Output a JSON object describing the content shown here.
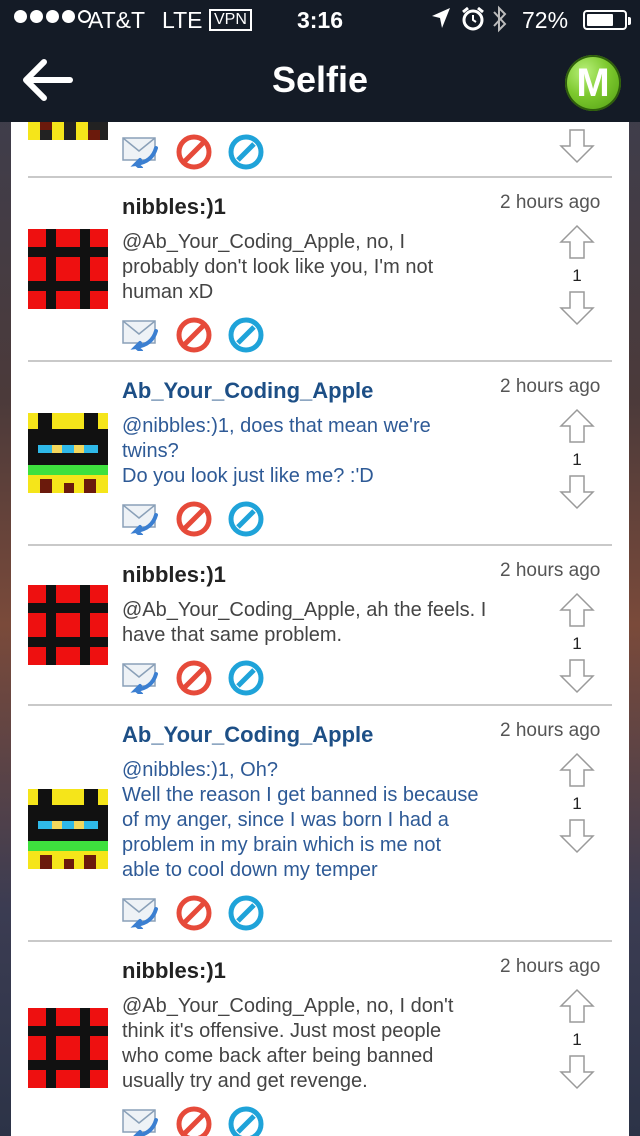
{
  "status_bar": {
    "carrier": "AT&T",
    "network": "LTE",
    "vpn": "VPN",
    "time": "3:16",
    "battery": "72%",
    "battery_level": 0.72,
    "icons": [
      "signal-dots",
      "location-icon",
      "alarm-icon",
      "bluetooth-icon",
      "battery-icon"
    ]
  },
  "nav": {
    "title": "Selfie",
    "back_icon": "back-arrow-icon",
    "menu_label": "M"
  },
  "colors": {
    "nav_bg": "#141b26",
    "menu_button": "#7cc82d",
    "username_blue": "#1d4f86",
    "body_blue": "#2e5a96",
    "deny_red": "#e64a3a",
    "edit_blue": "#1fa3d9"
  },
  "posts": [
    {
      "user": "nibbles:)1",
      "time": "2 hours ago",
      "lines": [
        "@Ab_Your_Coding_Apple, no, I",
        "probably don't look like you, I'm not",
        "human xD"
      ],
      "score": "1"
    },
    {
      "user": "Ab_Your_Coding_Apple",
      "time": "2 hours ago",
      "lines": [
        "@nibbles:)1, does that mean we're",
        "twins?",
        "Do you look just like me? :'D"
      ],
      "score": "1"
    },
    {
      "user": "nibbles:)1",
      "time": "2 hours ago",
      "lines": [
        "@Ab_Your_Coding_Apple, ah the feels. I",
        "have that same problem."
      ],
      "score": "1"
    },
    {
      "user": "Ab_Your_Coding_Apple",
      "time": "2 hours ago",
      "lines": [
        "@nibbles:)1, Oh?",
        "Well the reason I get banned is because",
        "of my anger, since I was born I had a",
        "problem in my brain which is me not",
        "able to cool down my temper"
      ],
      "score": "1"
    },
    {
      "user": "nibbles:)1",
      "time": "2 hours ago",
      "lines": [
        "@Ab_Your_Coding_Apple, no, I don't",
        "think it's offensive. Just most people",
        "who come back after being banned",
        "usually try and get revenge."
      ],
      "score": "1"
    }
  ]
}
